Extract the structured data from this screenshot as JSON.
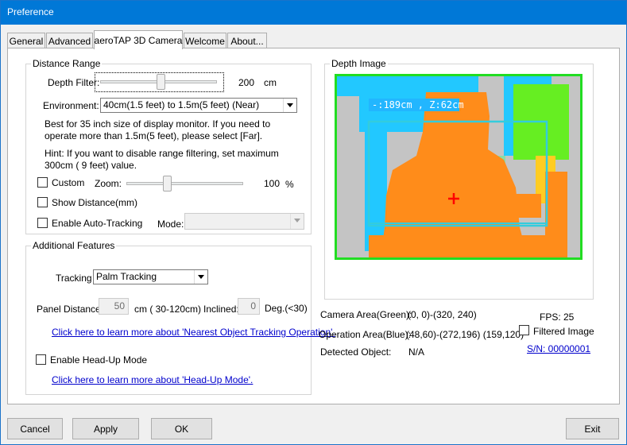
{
  "window": {
    "title": "Preference"
  },
  "tabs": [
    {
      "label": "General"
    },
    {
      "label": "Advanced"
    },
    {
      "label": "aeroTAP 3D Camera"
    },
    {
      "label": "Welcome"
    },
    {
      "label": "About..."
    }
  ],
  "distance_range": {
    "legend": "Distance Range",
    "depth_filter_label": "Depth Filter:",
    "depth_filter_value": 200,
    "depth_filter_value_text": "200",
    "depth_filter_unit": "cm",
    "environment_label": "Environment:",
    "environment_value": "40cm(1.5 feet) to 1.5m(5 feet) (Near)",
    "description": "Best for 35 inch size of display monitor. If you need to operate more than 1.5m(5 feet), please select [Far].",
    "hint": "Hint: If you want to disable range filtering, set maximum 300cm ( 9 feet) value.",
    "custom_label": "Custom",
    "custom_checked": false,
    "zoom_label": "Zoom:",
    "zoom_value": 100,
    "zoom_value_text": "100",
    "zoom_unit": "%",
    "show_distance_label": "Show Distance(mm)",
    "show_distance_checked": false,
    "auto_tracking_label": "Enable Auto-Tracking",
    "auto_tracking_checked": false,
    "mode_label": "Mode:",
    "mode_value": ""
  },
  "additional_features": {
    "legend": "Additional Features",
    "tracking_label": "Tracking",
    "tracking_value": "Palm Tracking",
    "panel_distance_label": "Panel Distance:",
    "panel_distance_value": "50",
    "panel_distance_unit": "cm ( 30-120cm)",
    "inclined_label": "Inclined:",
    "inclined_value": "0",
    "inclined_unit": "Deg.(<30)",
    "nearest_link": "Click here to learn more about 'Nearest Object Tracking Operation'.",
    "headup_label": "Enable Head-Up Mode",
    "headup_checked": false,
    "headup_link": "Click here to learn more about 'Head-Up Mode'."
  },
  "depth_image": {
    "legend": "Depth Image",
    "overlay_text": "-:189cm , Z:62cm"
  },
  "info": {
    "camera_area_label": "Camera Area(Green):",
    "camera_area_value": "(0, 0)-(320, 240)",
    "operation_area_label": "Operation Area(Blue):",
    "operation_area_value": "(48,60)-(272,196) (159,120)",
    "detected_object_label": "Detected Object:",
    "detected_object_value": "N/A",
    "fps_text": "FPS: 25",
    "filtered_image_label": "Filtered Image",
    "filtered_image_checked": false,
    "serial_link": "S/N: 00000001"
  },
  "buttons": {
    "cancel": "Cancel",
    "apply": "Apply",
    "ok": "OK",
    "exit": "Exit"
  },
  "colors": {
    "titlebar": "#0078d7",
    "camera_area_frame": "#22dd22",
    "operation_area_frame": "#33ccdd",
    "depth_near": "#ff8c1a",
    "depth_mid": "#22c8ff",
    "depth_far": "#44ee22",
    "crosshair": "#ff0000",
    "link": "#0000cc"
  }
}
